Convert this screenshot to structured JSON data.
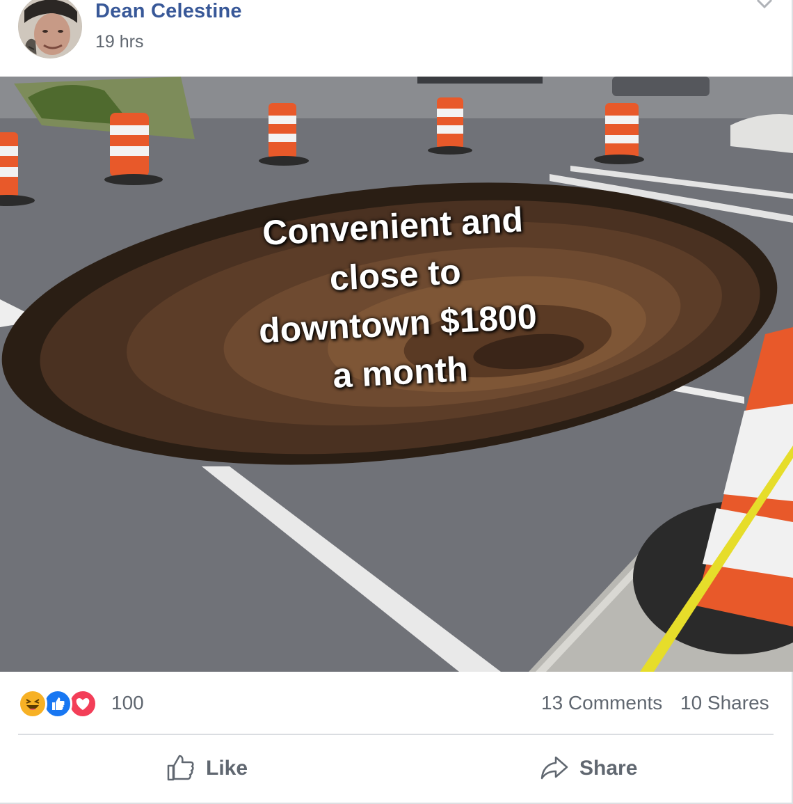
{
  "post": {
    "author": "Dean Celestine",
    "time": "19 hrs",
    "image": {
      "caption_lines": [
        "Convenient and",
        "close to",
        "downtown $1800",
        "a month"
      ]
    },
    "stats": {
      "reaction_icons": [
        "haha-icon",
        "like-icon",
        "love-icon"
      ],
      "reaction_count": "100",
      "comments": "13 Comments",
      "shares": "10 Shares"
    },
    "actions": {
      "like_label": "Like",
      "share_label": "Share"
    }
  },
  "colors": {
    "author_link": "#385898",
    "secondary_text": "#606770",
    "like_blue": "#1877f2",
    "love_red": "#f33e58",
    "haha_yellow": "#f7b125"
  }
}
